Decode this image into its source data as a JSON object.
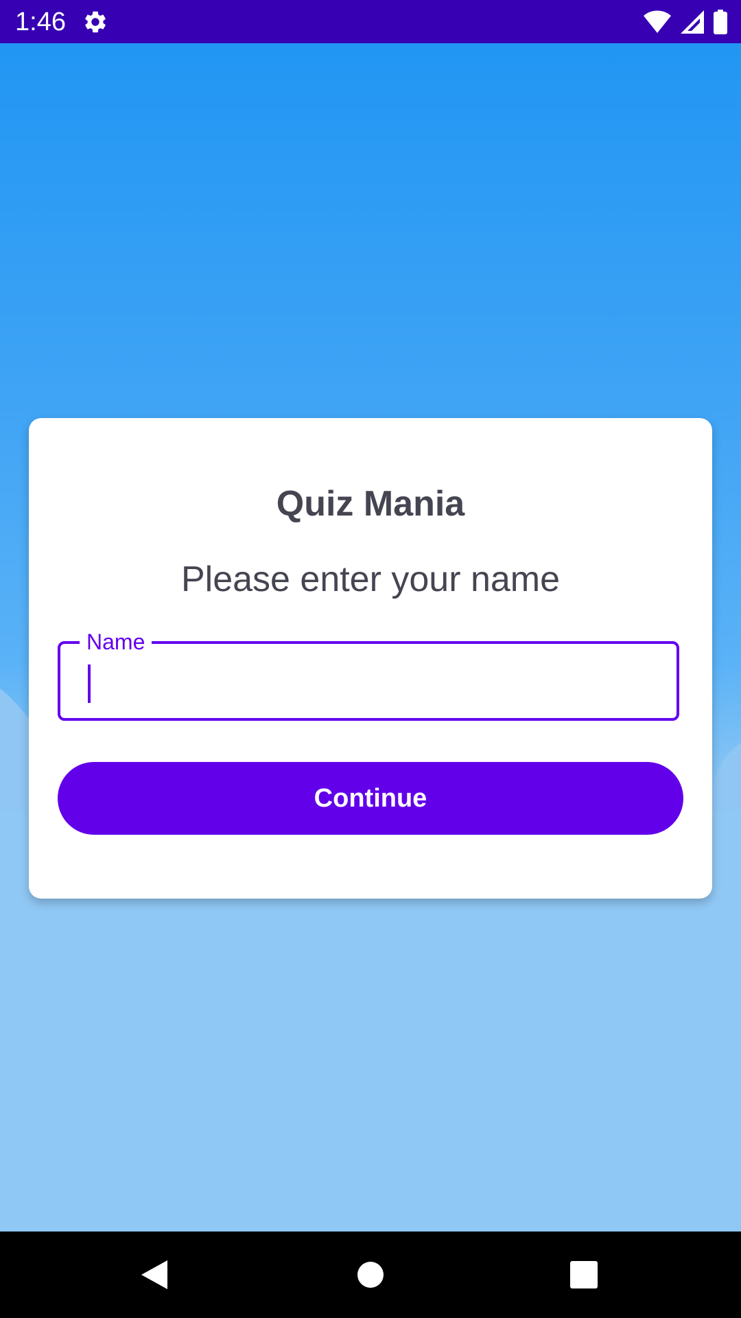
{
  "status_bar": {
    "time": "1:46",
    "settings_icon": "gear-icon",
    "wifi_icon": "wifi-icon",
    "signal_icon": "signal-icon",
    "battery_icon": "battery-icon"
  },
  "card": {
    "title": "Quiz Mania",
    "subtitle": "Please enter your name",
    "name_field": {
      "label": "Name",
      "value": "",
      "placeholder": ""
    },
    "continue_label": "Continue"
  },
  "nav_bar": {
    "back_icon": "back-triangle-icon",
    "home_icon": "home-circle-icon",
    "recents_icon": "recents-square-icon"
  },
  "colors": {
    "status_bar": "#3700b3",
    "accent": "#6200ee",
    "sky_top": "#2196f3",
    "sky_bottom": "#90c8f5",
    "text": "#454552"
  }
}
